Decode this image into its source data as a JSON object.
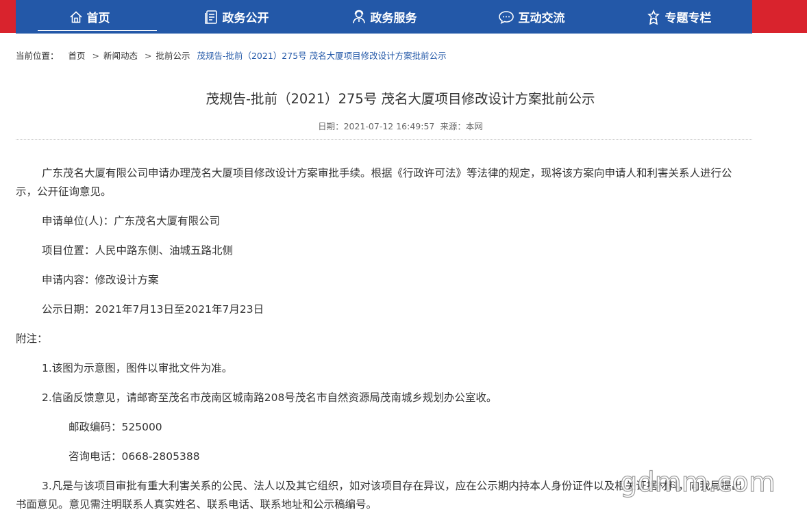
{
  "nav": {
    "items": [
      {
        "label": "首页",
        "icon": "home-icon",
        "active": true
      },
      {
        "label": "政务公开",
        "icon": "document-icon",
        "active": false
      },
      {
        "label": "政务服务",
        "icon": "service-person-icon",
        "active": false
      },
      {
        "label": "互动交流",
        "icon": "chat-bubble-icon",
        "active": false
      },
      {
        "label": "专题专栏",
        "icon": "ribbon-icon",
        "active": false
      }
    ]
  },
  "colors": {
    "nav_bg": "#2358a8",
    "top_band": "#d9232d",
    "breadcrumb_current": "#2358a8"
  },
  "breadcrumb": {
    "prefix": "当前位置：",
    "items": [
      "首页",
      "新闻动态",
      "批前公示"
    ],
    "current": "茂规告-批前（2021）275号 茂名大厦项目修改设计方案批前公示"
  },
  "article": {
    "title": "茂规告-批前（2021）275号 茂名大厦项目修改设计方案批前公示",
    "date_label": "日期：",
    "date": "2021-07-12 16:49:57",
    "source_label": "来源：",
    "source": "本网",
    "paragraphs": {
      "intro": "广东茂名大厦有限公司申请办理茂名大厦项目修改设计方案审批手续。根据《行政许可法》等法律的规定，现将该方案向申请人和利害关系人进行公示，公开征询意见。",
      "applicant": "申请单位(人)：广东茂名大厦有限公司",
      "location": "项目位置：人民中路东侧、油城五路北侧",
      "content": "申请内容：修改设计方案",
      "period": "公示日期：2021年7月13日至2021年7月23日",
      "notes_heading": "附注：",
      "note1": "1.该图为示意图，图件以审批文件为准。",
      "note2": "2.信函反馈意见，请邮寄至茂名市茂南区城南路208号茂名市自然资源局茂南城乡规划办公室收。",
      "postcode": "邮政编码：525000",
      "phone": "咨询电话：0668-2805388",
      "note3": "3.凡是与该项目审批有重大利害关系的公民、法人以及其它组织，如对该项目存在异议，应在公示期内持本人身份证件以及相关证据材料，向我局提出书面意见。意见需注明联系人真实姓名、联系电话、联系地址和公示稿编号。"
    }
  },
  "watermark": "gdmm.com"
}
